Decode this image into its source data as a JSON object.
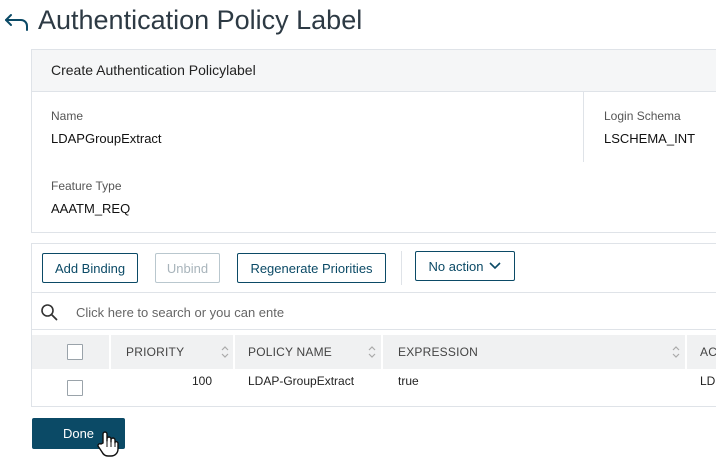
{
  "header": {
    "title": "Authentication Policy Label"
  },
  "panel": {
    "title": "Create Authentication Policylabel",
    "name_label": "Name",
    "name_value": "LDAPGroupExtract",
    "login_schema_label": "Login Schema",
    "login_schema_value": "LSCHEMA_INT",
    "feature_type_label": "Feature Type",
    "feature_type_value": "AAATM_REQ"
  },
  "toolbar": {
    "add_binding": "Add Binding",
    "unbind": "Unbind",
    "regenerate": "Regenerate Priorities",
    "action_select": "No action"
  },
  "search": {
    "placeholder": "Click here to search or you can ente"
  },
  "table": {
    "columns": [
      "PRIORITY",
      "POLICY NAME",
      "EXPRESSION",
      "AC"
    ],
    "rows": [
      {
        "priority": "100",
        "policy_name": "LDAP-GroupExtract",
        "expression": "true",
        "action": "LD"
      }
    ]
  },
  "footer": {
    "done": "Done"
  },
  "colors": {
    "accent": "#0b4a66",
    "border": "#dfe3e8",
    "header_bg": "#f5f6f7"
  }
}
